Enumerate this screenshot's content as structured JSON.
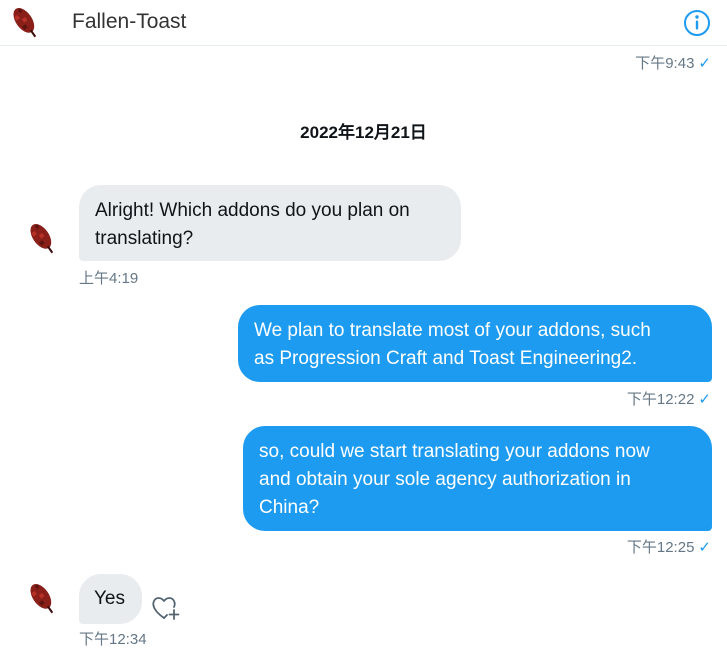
{
  "header": {
    "contact_name": "Fallen-Toast",
    "info_icon": "info-icon",
    "avatar_icon": "red-feather-avatar"
  },
  "top_timestamp": {
    "time": "下午9:43",
    "status": "✓"
  },
  "date_separator": "2022年12月21日",
  "messages": [
    {
      "direction": "incoming",
      "text": "Alright! Which addons do you plan on translating?",
      "line1": "Alright! Which addons do you plan on",
      "line2": "translating?",
      "time": "上午4:19"
    },
    {
      "direction": "outgoing",
      "text": "We plan to translate most of your addons, such as Progression Craft and Toast Engineering2.",
      "line1": "We plan to translate most of your addons, such",
      "line2": "as Progression Craft and Toast Engineering2.",
      "time": "下午12:22",
      "status": "✓"
    },
    {
      "direction": "outgoing",
      "text": "so, could we start translating your addons now and obtain your sole agency authorization in China?",
      "line1": "so, could we start translating your addons now",
      "line2": "and obtain your sole agency authorization in",
      "line3": "China?",
      "time": "下午12:25",
      "status": "✓"
    },
    {
      "direction": "incoming",
      "text": "Yes",
      "time": "下午12:34",
      "reaction_icon": "heart-plus-icon"
    }
  ],
  "colors": {
    "outgoing_bubble": "#1d9bf0",
    "incoming_bubble": "#e9ecef",
    "timestamp": "#657786",
    "check": "#1d9bf0"
  }
}
